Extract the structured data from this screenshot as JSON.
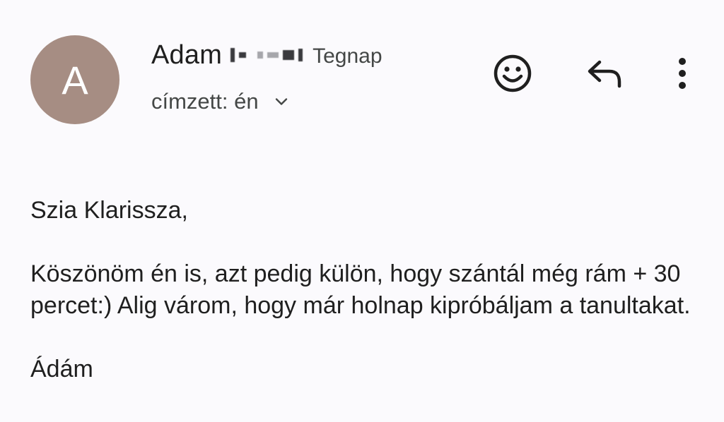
{
  "header": {
    "avatar_letter": "A",
    "avatar_color": "#a68d83",
    "sender_name": "Adam",
    "time": "Tegnap",
    "recipient_label": "címzett: én",
    "icons": [
      "emoji-icon",
      "reply-icon",
      "more-vert-icon",
      "chevron-down-icon"
    ]
  },
  "message": {
    "greeting": "Szia Klarissza,",
    "paragraph": "Köszönöm én is, azt pedig külön, hogy szántál még rám + 30 percet:) Alig várom, hogy már holnap kipróbáljam a tanultakat.",
    "signature": "Ádám"
  }
}
